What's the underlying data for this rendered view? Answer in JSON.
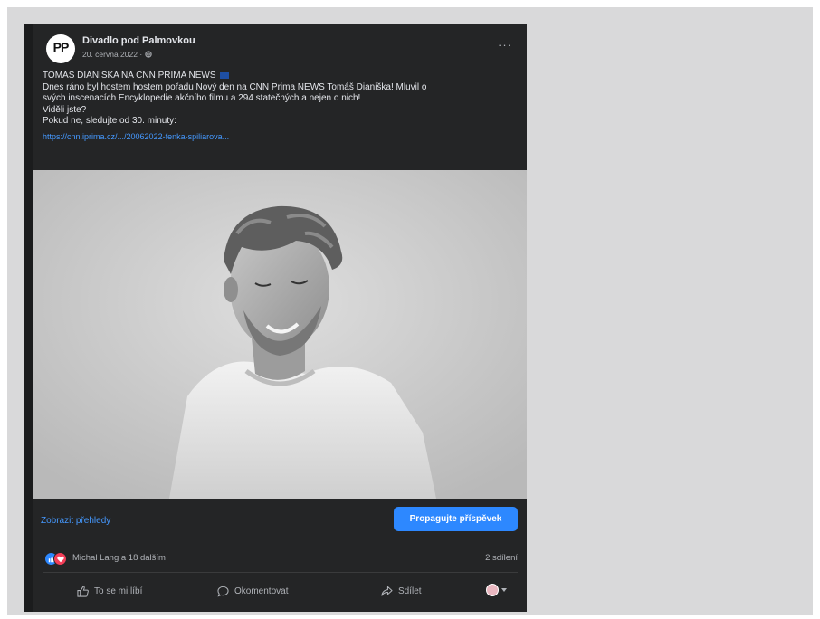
{
  "post": {
    "page_name": "Divadlo pod Palmovkou",
    "avatar_initials": "PP",
    "date": "20. června 2022 ·",
    "more_label": "···",
    "text_lines": [
      "TOMÁŠ DIANIŠKA NA CNN PRIMA NEWS",
      "Dnes ráno byl hostem hostem pořadu Nový den na CNN Prima NEWS Tomáš Dianiška! Mluvil o",
      "svých inscenacích Encyklopedie akčního filmu a 294 statečných a nejen o nich!",
      "Viděli jste?",
      "Pokud ne, sledujte od 30. minuty:"
    ],
    "link": "https://cnn.iprima.cz/.../20062022-fenka-spiliarova...",
    "flag_icon": "czech-flag-emoji"
  },
  "promo": {
    "insights_label": "Zobrazit přehledy",
    "promote_label": "Propagujte příspěvek",
    "promote_color": "#2d88ff"
  },
  "reactions": {
    "icons": [
      "like-icon",
      "love-icon"
    ],
    "names": "Michal Lang a 18 dalším",
    "shares": "2 sdílení"
  },
  "actions": {
    "like": "To se mi líbí",
    "comment": "Okomentovat",
    "share": "Sdílet"
  }
}
